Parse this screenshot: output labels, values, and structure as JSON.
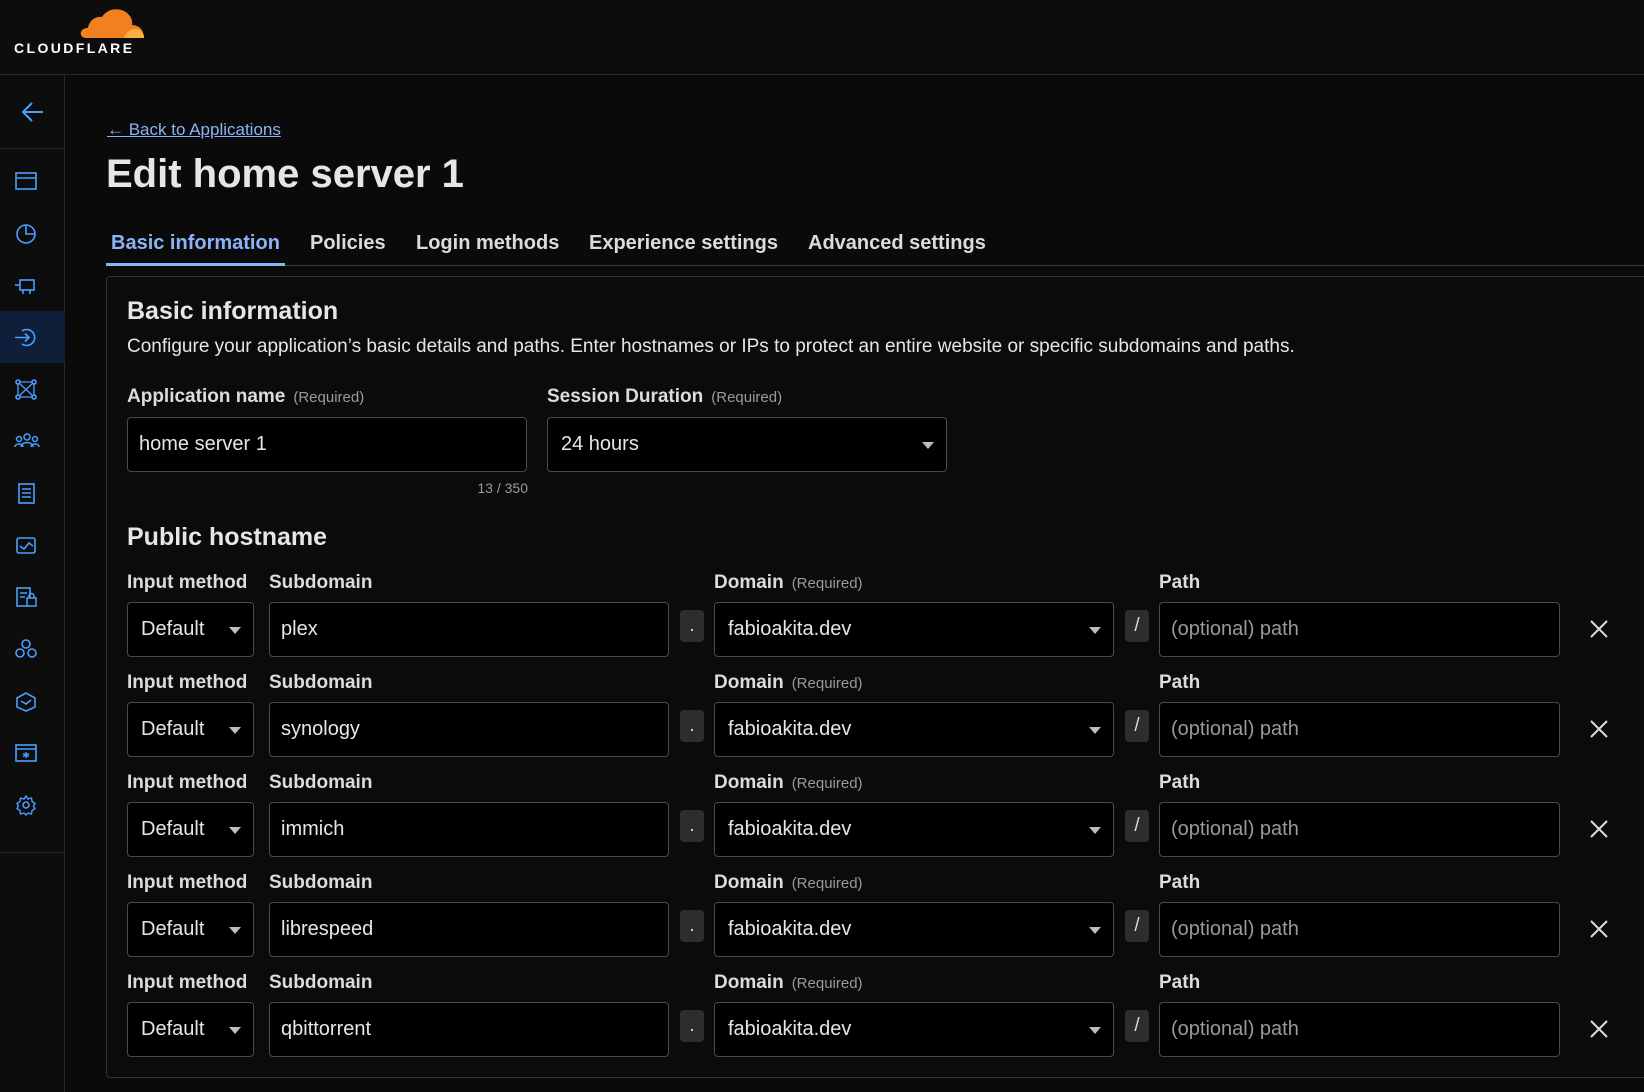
{
  "header": {
    "logo_text": "CLOUDFLARE",
    "brand_color": "#f38020"
  },
  "sidebar": {
    "accent": "#4a9eff",
    "back_icon": "arrow-left-icon",
    "items": [
      {
        "icon": "browser-window-icon"
      },
      {
        "icon": "pie-chart-icon"
      },
      {
        "icon": "gateway-icon"
      },
      {
        "icon": "access-icon",
        "active": true
      },
      {
        "icon": "network-icon"
      },
      {
        "icon": "users-icon"
      },
      {
        "icon": "logs-icon"
      },
      {
        "icon": "dex-icon"
      },
      {
        "icon": "email-security-icon"
      },
      {
        "icon": "integrations-icon"
      },
      {
        "icon": "casb-icon"
      },
      {
        "icon": "browser-isolation-icon"
      },
      {
        "icon": "settings-gear-icon"
      }
    ]
  },
  "breadcrumb": {
    "back_label": "← Back to Applications"
  },
  "page": {
    "title": "Edit home server 1"
  },
  "tabs": [
    {
      "label": "Basic information",
      "active": true
    },
    {
      "label": "Policies"
    },
    {
      "label": "Login methods"
    },
    {
      "label": "Experience settings"
    },
    {
      "label": "Advanced settings"
    }
  ],
  "basic_info": {
    "heading": "Basic information",
    "description": "Configure your application’s basic details and paths. Enter hostnames or IPs to protect an entire website or specific subdomains and paths.",
    "app_name": {
      "label": "Application name",
      "required": "(Required)",
      "value": "home server 1",
      "counter": "13 / 350"
    },
    "session_duration": {
      "label": "Session Duration",
      "required": "(Required)",
      "value": "24 hours"
    }
  },
  "public_hostname": {
    "heading": "Public hostname",
    "labels": {
      "input_method": "Input method",
      "subdomain": "Subdomain",
      "domain": "Domain",
      "required": "(Required)",
      "path": "Path"
    },
    "dot": ".",
    "slash": "/",
    "path_placeholder": "(optional) path",
    "rows": [
      {
        "input_method": "Default",
        "subdomain": "plex",
        "domain": "fabioakita.dev"
      },
      {
        "input_method": "Default",
        "subdomain": "synology",
        "domain": "fabioakita.dev"
      },
      {
        "input_method": "Default",
        "subdomain": "immich",
        "domain": "fabioakita.dev"
      },
      {
        "input_method": "Default",
        "subdomain": "librespeed",
        "domain": "fabioakita.dev"
      },
      {
        "input_method": "Default",
        "subdomain": "qbittorrent",
        "domain": "fabioakita.dev"
      }
    ]
  }
}
